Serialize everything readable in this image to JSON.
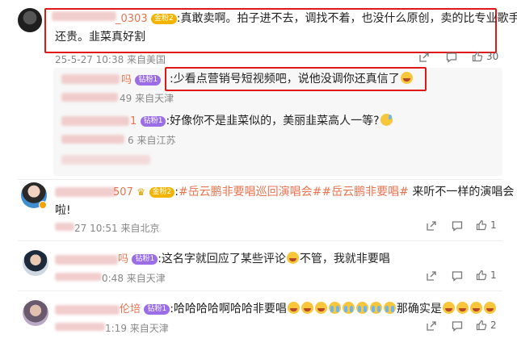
{
  "comments": [
    {
      "name": "_0303",
      "badge": "金粉2",
      "text_line1": ":真敢卖啊。拍子进不去，调找不着，也没什么原创，卖的比专业歌手",
      "text_line2": "还贵。韭菜真好割",
      "meta": "25-5-27 10:38 来自美国",
      "likes": "30"
    },
    {
      "name": "吗",
      "badge": "钻粉1",
      "text": ":少看点营销号短视频吧，说他没调你还真信了",
      "meta": "49 来自天津"
    },
    {
      "name": "1",
      "badge": "钻粉1",
      "text": ":好像你不是韭菜似的，美丽韭菜高人一等?",
      "meta": "6 来自江苏"
    },
    {
      "name": "507",
      "badge": "金粉2",
      "text_pre": ":",
      "tag1": "#岳云鹏非要唱巡回演唱会#",
      "tag2": "#岳云鹏非要唱#",
      "text_post": " 来听不一样的演唱会",
      "text_line2": "啦!",
      "meta": "27 10:51 来自北京",
      "likes": "1"
    },
    {
      "name": "吗",
      "badge": "钻粉1",
      "text_pre": ":这名字就回应了某些评论",
      "text_post": "不管，我就非要唱",
      "meta": "0:48 来自天津",
      "likes": "1"
    },
    {
      "name": "伦培",
      "badge": "钻粉1",
      "text_pre": ":哈哈哈哈啊哈哈非要唱",
      "text_mid": "那确实是",
      "meta": "1:19 来自天津",
      "likes": "2"
    }
  ],
  "icons": {
    "share": "share-icon",
    "comment": "comment-icon",
    "like": "like-icon"
  },
  "colors": {
    "name": "#eb7350",
    "highlight_box": "#e11818",
    "gold_badge": "#f3b400",
    "purple_badge": "#9b6ee8"
  }
}
